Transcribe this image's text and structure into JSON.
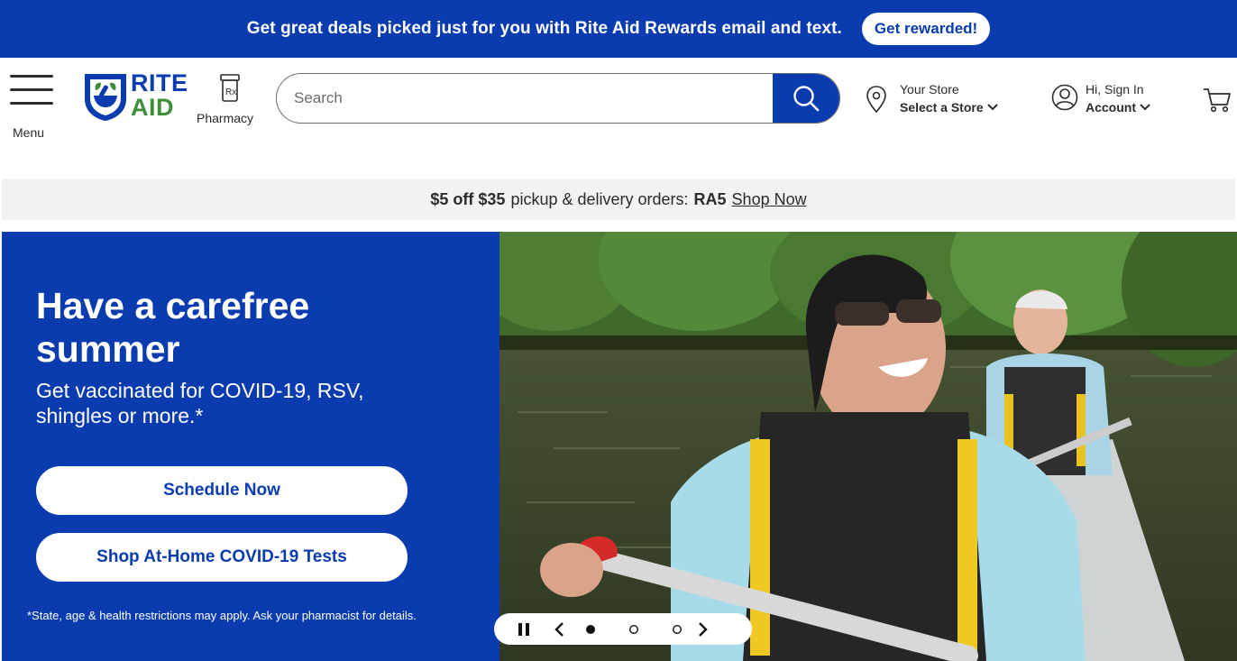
{
  "top_banner": {
    "text": "Get great deals picked just for you with Rite Aid Rewards email and text.",
    "button": "Get rewarded!"
  },
  "header": {
    "menu_label": "Menu",
    "logo": {
      "line1": "RITE",
      "line2": "AID"
    },
    "pharmacy_label": "Pharmacy",
    "search": {
      "placeholder": "Search",
      "value": ""
    },
    "store": {
      "line1": "Your Store",
      "line2": "Select a Store"
    },
    "account": {
      "line1": "Hi, Sign In",
      "line2": "Account"
    }
  },
  "promo": {
    "offer": "$5 off $35",
    "text": "pickup & delivery orders:",
    "code": "RA5",
    "link": "Shop Now"
  },
  "hero": {
    "title": "Have a carefree summer",
    "subtitle": "Get vaccinated for COVID-19, RSV, shingles or more.*",
    "button1": "Schedule Now",
    "button2": "Shop At-Home COVID-19 Tests",
    "note": "*State, age & health restrictions may apply. Ask your pharmacist for details."
  },
  "carousel": {
    "slides": 3,
    "active": 1
  },
  "colors": {
    "brand_blue": "#0a3cb0",
    "brand_green": "#3f8f3a",
    "promo_bg": "#f2f2f2"
  },
  "icons": [
    "hamburger-icon",
    "pharmacy-bottle-icon",
    "search-icon",
    "location-pin-icon",
    "user-icon",
    "cart-icon",
    "chevron-down-icon",
    "pause-icon",
    "chevron-left-icon",
    "chevron-right-icon"
  ]
}
